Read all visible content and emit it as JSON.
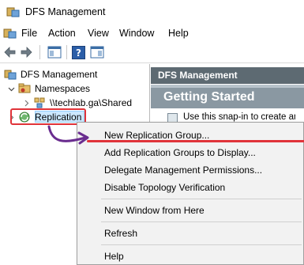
{
  "window": {
    "title": "DFS Management",
    "app_icon": "dfs-management-icon"
  },
  "menubar": {
    "items": [
      {
        "label": "File"
      },
      {
        "label": "Action"
      },
      {
        "label": "View"
      },
      {
        "label": "Window"
      },
      {
        "label": "Help"
      }
    ]
  },
  "toolbar": {
    "buttons": [
      {
        "icon": "back-arrow-icon"
      },
      {
        "icon": "forward-arrow-icon"
      },
      {
        "icon": "show-hide-console-tree-icon"
      },
      {
        "icon": "help-icon"
      },
      {
        "icon": "show-hide-action-pane-icon"
      }
    ]
  },
  "tree": {
    "root": {
      "label": "DFS Management",
      "icon": "dfs-management-icon"
    },
    "namespaces": {
      "label": "Namespaces",
      "icon": "namespaces-icon"
    },
    "namespace_item": {
      "label": "\\\\techlab.ga\\Shared",
      "icon": "namespace-icon"
    },
    "replication": {
      "label": "Replication",
      "icon": "replication-icon",
      "selected": true
    }
  },
  "right_pane": {
    "header": "DFS Management",
    "getting_started": "Getting Started",
    "body_text": "Use this snap-in to create and"
  },
  "context_menu": {
    "items": [
      {
        "label": "New Replication Group...",
        "highlighted": true
      },
      {
        "label": "Add Replication Groups to Display..."
      },
      {
        "label": "Delegate Management Permissions..."
      },
      {
        "label": "Disable Topology Verification"
      },
      {
        "separator": true
      },
      {
        "label": "New Window from Here"
      },
      {
        "separator": true
      },
      {
        "label": "Refresh"
      },
      {
        "separator": true
      },
      {
        "label": "Help"
      }
    ]
  },
  "colors": {
    "highlight_red": "#e0343a",
    "arrow_purple": "#6a2d8f",
    "header_gray": "#5d6a72",
    "selection_blue": "#cce8ff"
  }
}
